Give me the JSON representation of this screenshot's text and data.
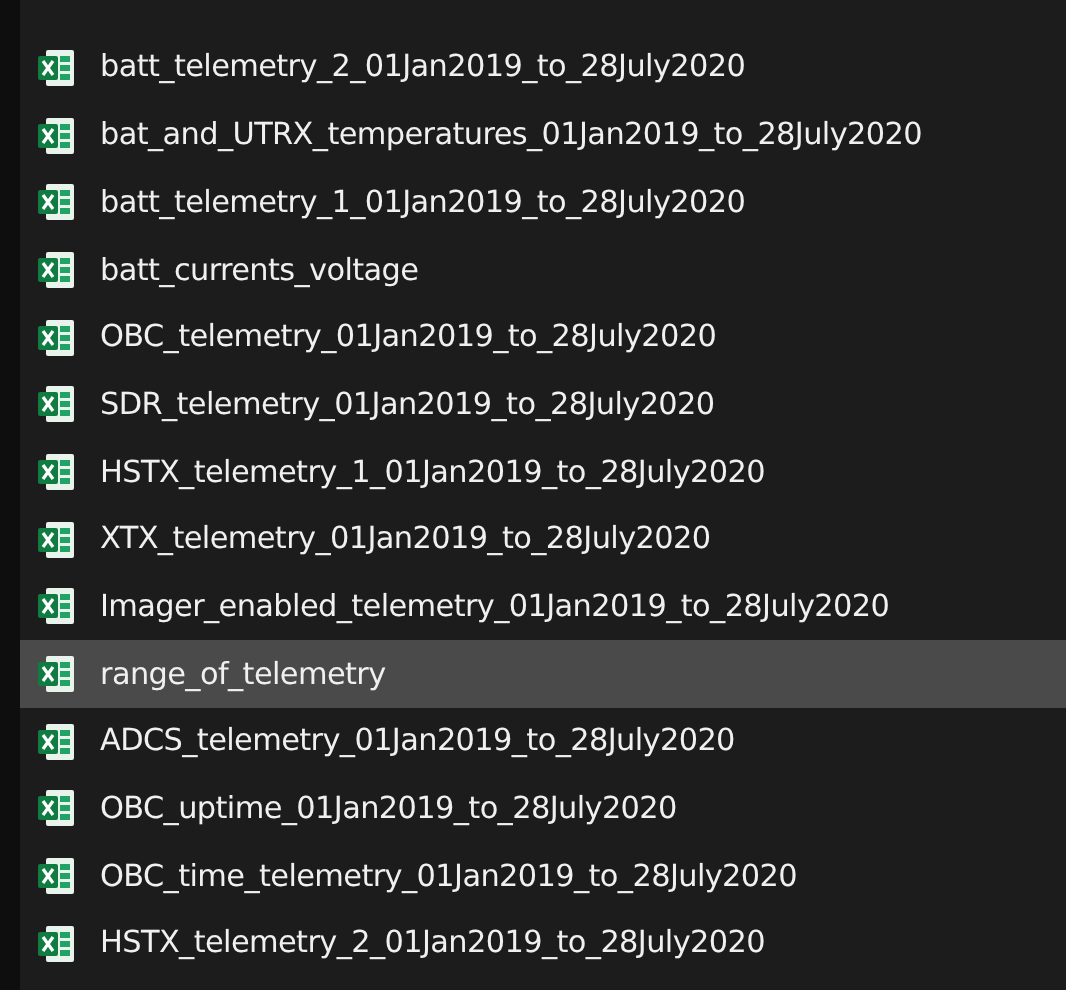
{
  "files": [
    {
      "name": "batt_telemetry_2_01Jan2019_to_28July2020",
      "selected": false
    },
    {
      "name": "bat_and_UTRX_temperatures_01Jan2019_to_28July2020",
      "selected": false
    },
    {
      "name": "batt_telemetry_1_01Jan2019_to_28July2020",
      "selected": false
    },
    {
      "name": "batt_currents_voltage",
      "selected": false
    },
    {
      "name": "OBC_telemetry_01Jan2019_to_28July2020",
      "selected": false
    },
    {
      "name": "SDR_telemetry_01Jan2019_to_28July2020",
      "selected": false
    },
    {
      "name": "HSTX_telemetry_1_01Jan2019_to_28July2020",
      "selected": false
    },
    {
      "name": "XTX_telemetry_01Jan2019_to_28July2020",
      "selected": false
    },
    {
      "name": "Imager_enabled_telemetry_01Jan2019_to_28July2020",
      "selected": false
    },
    {
      "name": "range_of_telemetry",
      "selected": true
    },
    {
      "name": "ADCS_telemetry_01Jan2019_to_28July2020",
      "selected": false
    },
    {
      "name": "OBC_uptime_01Jan2019_to_28July2020",
      "selected": false
    },
    {
      "name": "OBC_time_telemetry_01Jan2019_to_28July2020",
      "selected": false
    },
    {
      "name": "HSTX_telemetry_2_01Jan2019_to_28July2020",
      "selected": false
    }
  ]
}
